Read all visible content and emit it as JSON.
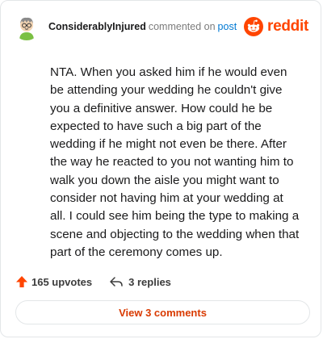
{
  "header": {
    "username": "ConsiderablyInjured",
    "action_text": "commented on",
    "post_link": "post",
    "brand_wordmark": "reddit",
    "brand_color": "#ff4500",
    "link_color": "#0079d3"
  },
  "comment": {
    "body": "NTA. When you asked him if he would even be attending your wedding he couldn't give you a definitive answer. How could he be expected to have such a big part of the wedding if he might not even be there. After the way he reacted to you not wanting him to walk you down the aisle you might want to consider not having him at your wedding at all. I could see him being the type to making a scene and objecting to the wedding when that part of the ceremony comes up."
  },
  "actions": {
    "upvotes": "165 upvotes",
    "replies": "3 replies",
    "upvote_icon": "upvote-arrow-icon",
    "reply_icon": "reply-arrow-icon",
    "upvote_color": "#ff4500"
  },
  "view_button": {
    "label": "View 3 comments",
    "color": "#d93a00"
  }
}
